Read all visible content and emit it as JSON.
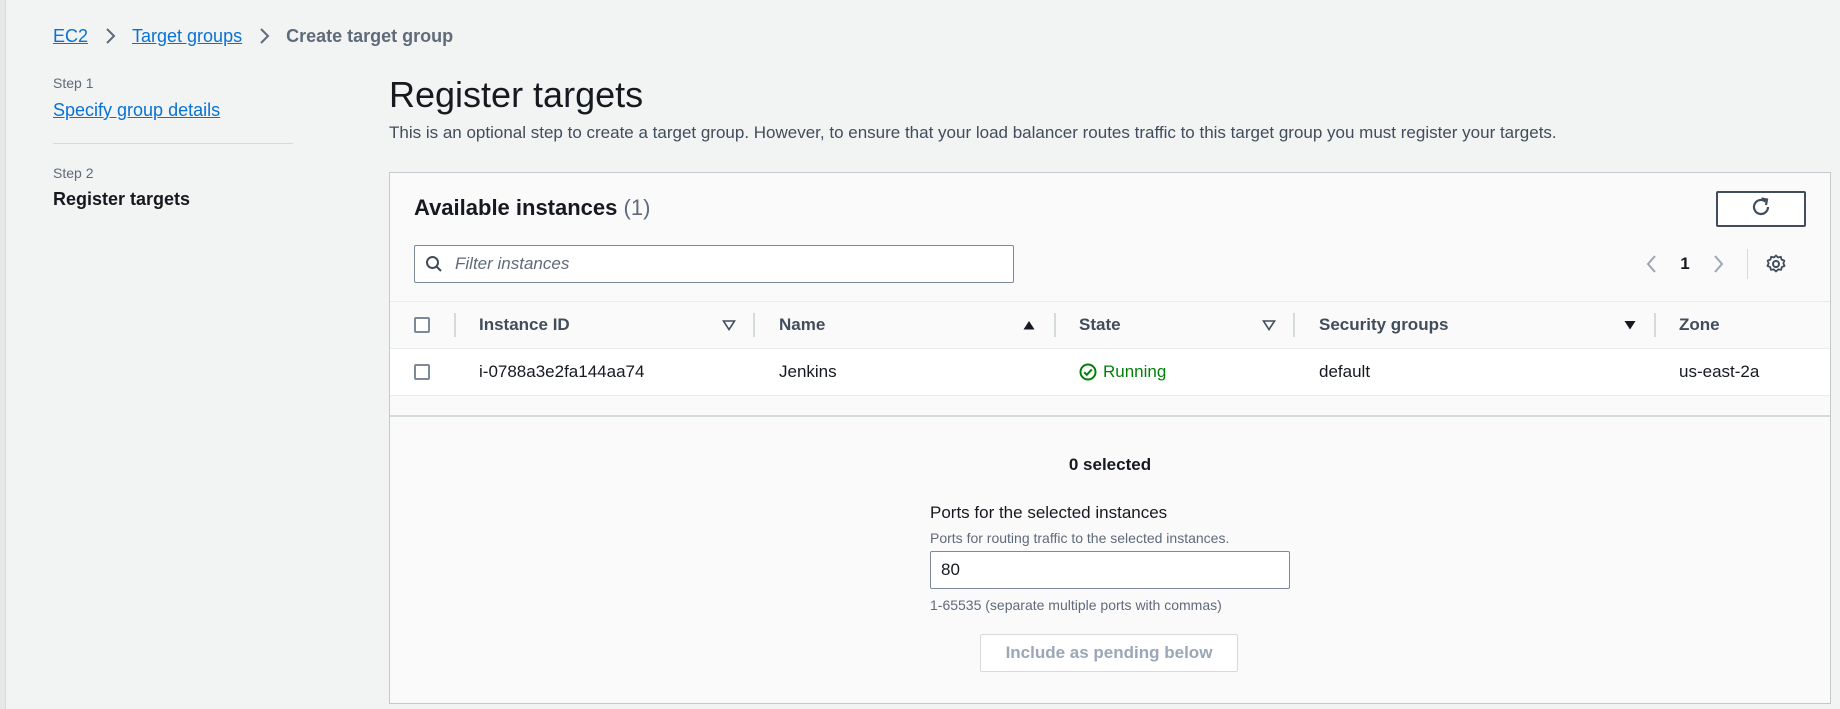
{
  "breadcrumb": {
    "items": [
      "EC2",
      "Target groups"
    ],
    "current": "Create target group"
  },
  "steps": {
    "step1_label": "Step 1",
    "step1_title": "Specify group details",
    "step2_label": "Step 2",
    "step2_title": "Register targets"
  },
  "page": {
    "title": "Register targets",
    "description": "This is an optional step to create a target group. However, to ensure that your load balancer routes traffic to this target group you must register your targets."
  },
  "instances": {
    "title": "Available instances",
    "count": "(1)",
    "filter_placeholder": "Filter instances",
    "page_number": "1",
    "columns": [
      "Instance ID",
      "Name",
      "State",
      "Security groups",
      "Zone"
    ],
    "rows": [
      {
        "instance_id": "i-0788a3e2fa144aa74",
        "name": "Jenkins",
        "state": "Running",
        "security_groups": "default",
        "zone": "us-east-2a"
      }
    ]
  },
  "selection": {
    "selected_text": "0 selected",
    "ports_label": "Ports for the selected instances",
    "ports_description": "Ports for routing traffic to the selected instances.",
    "ports_value": "80",
    "ports_hint": "1-65535 (separate multiple ports with commas)",
    "pending_button": "Include as pending below"
  },
  "colors": {
    "link": "#0972d3",
    "running": "#037f0c",
    "background": "#f2f3f3"
  },
  "icons": [
    "chevron-right-icon",
    "search-icon",
    "refresh-icon",
    "chevron-left-icon",
    "settings-gear-icon",
    "sort-down-icon",
    "sort-up-icon",
    "check-circle-icon"
  ]
}
